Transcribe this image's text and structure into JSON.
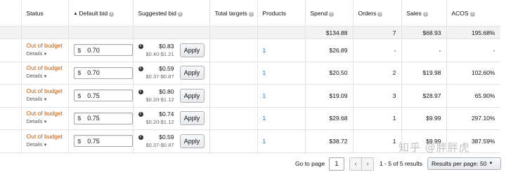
{
  "columns": {
    "status": "Status",
    "default_bid": "Default bid",
    "suggested_bid": "Suggested bid",
    "total_targets": "Total targets",
    "products": "Products",
    "spend": "Spend",
    "orders": "Orders",
    "sales": "Sales",
    "acos": "ACOS"
  },
  "totals": {
    "spend": "$134.88",
    "orders": "7",
    "sales": "$68.93",
    "acos": "195.68%"
  },
  "rows": [
    {
      "status": "Out of budget",
      "details": "Details",
      "currency": "$",
      "bid": "0.70",
      "suggested": "$0.83",
      "range": "$0.40-$1.21",
      "apply": "Apply",
      "products": "1",
      "spend": "$26.89",
      "orders": "-",
      "sales": "-",
      "acos": "-"
    },
    {
      "status": "Out of budget",
      "details": "Details",
      "currency": "$",
      "bid": "0.70",
      "suggested": "$0.59",
      "range": "$0.37-$0.87",
      "apply": "Apply",
      "products": "1",
      "spend": "$20.50",
      "orders": "2",
      "sales": "$19.98",
      "acos": "102.60%"
    },
    {
      "status": "Out of budget",
      "details": "Details",
      "currency": "$",
      "bid": "0.75",
      "suggested": "$0.80",
      "range": "$0.20-$1.12",
      "apply": "Apply",
      "products": "1",
      "spend": "$19.09",
      "orders": "3",
      "sales": "$28.97",
      "acos": "65.90%"
    },
    {
      "status": "Out of budget",
      "details": "Details",
      "currency": "$",
      "bid": "0.75",
      "suggested": "$0.74",
      "range": "$0.20-$1.12",
      "apply": "Apply",
      "products": "1",
      "spend": "$29.68",
      "orders": "1",
      "sales": "$9.99",
      "acos": "297.10%"
    },
    {
      "status": "Out of budget",
      "details": "Details",
      "currency": "$",
      "bid": "0.75",
      "suggested": "$0.59",
      "range": "$0.37-$0.87",
      "apply": "Apply",
      "products": "1",
      "spend": "$38.72",
      "orders": "1",
      "sales": "$9.99",
      "acos": "387.59%"
    }
  ],
  "pagination": {
    "go_to_page_label": "Go to page",
    "page_value": "1",
    "prev_icon": "chevron-left-icon",
    "next_icon": "chevron-right-icon",
    "results_text": "1 - 5 of 5 results",
    "per_page_label": "Results per page: 50"
  },
  "watermark": "知乎 @胖胖虎"
}
